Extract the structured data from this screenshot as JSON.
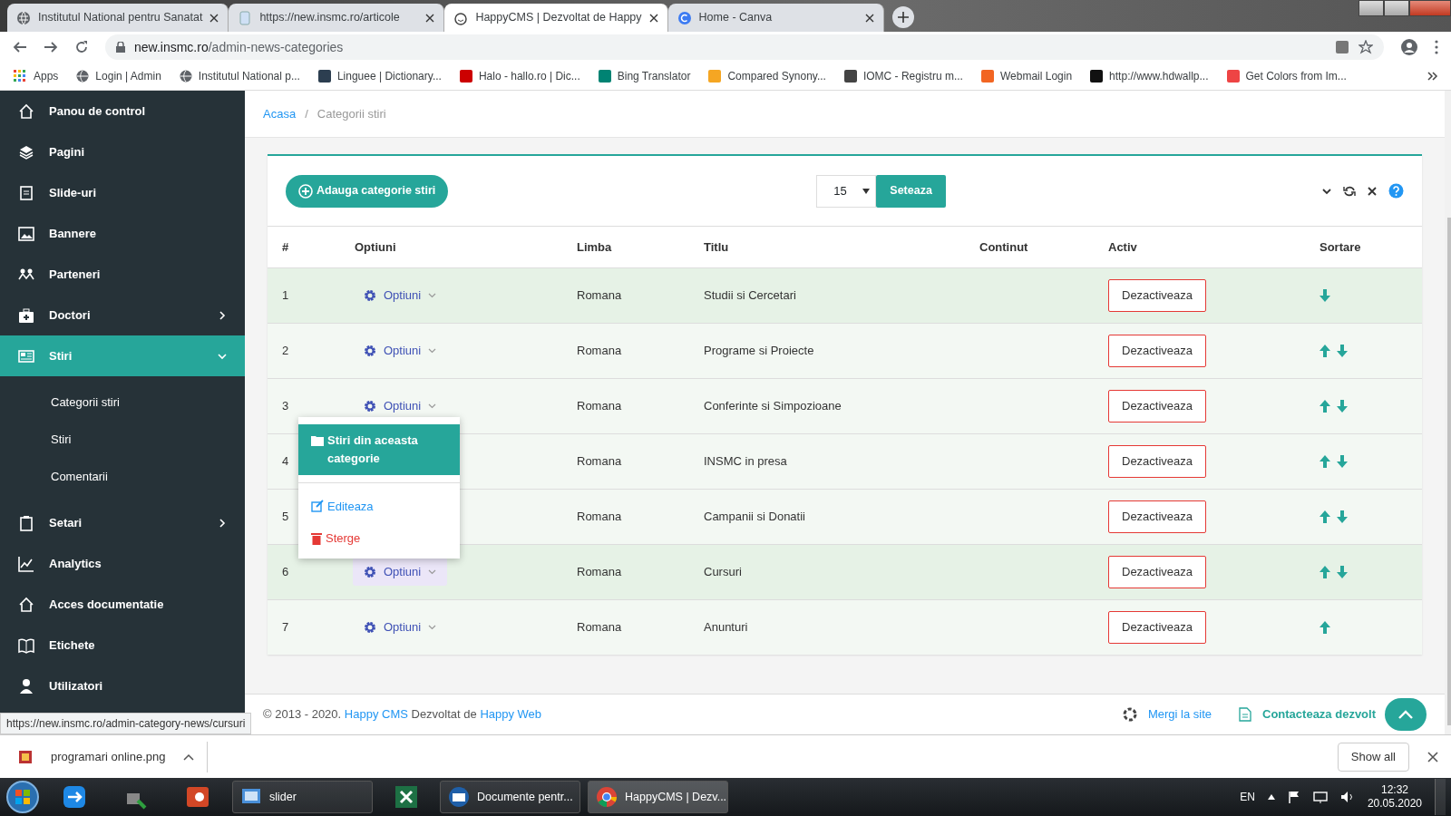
{
  "browser": {
    "tabs": [
      {
        "title": "Institutul National pentru Sanatat",
        "selected": false
      },
      {
        "title": "https://new.insmc.ro/articole",
        "selected": false
      },
      {
        "title": "HappyCMS | Dezvoltat de Happy",
        "selected": true
      },
      {
        "title": "Home - Canva",
        "selected": false
      }
    ],
    "address": {
      "host": "new.insmc.ro",
      "path": "/admin-news-categories"
    },
    "bookmarks": [
      "Apps",
      "Login | Admin",
      "Institutul National p...",
      "Linguee | Dictionary...",
      "Halo - hallo.ro | Dic...",
      "Bing Translator",
      "Compared Synony...",
      "IOMC - Registru m...",
      "Webmail Login",
      "http://www.hdwallp...",
      "Get Colors from Im..."
    ]
  },
  "sidebar": {
    "items": [
      {
        "label": "Panou de control",
        "kind": "link",
        "selected": false
      },
      {
        "label": "Pagini",
        "kind": "link",
        "selected": false
      },
      {
        "label": "Slide-uri",
        "kind": "link",
        "selected": false
      },
      {
        "label": "Bannere",
        "kind": "link",
        "selected": false
      },
      {
        "label": "Parteneri",
        "kind": "link",
        "selected": false
      },
      {
        "label": "Doctori",
        "kind": "submenu",
        "selected": false,
        "expanded": false
      },
      {
        "label": "Stiri",
        "kind": "submenu",
        "selected": true,
        "expanded": true,
        "children": [
          {
            "label": "Categorii stiri"
          },
          {
            "label": "Stiri"
          },
          {
            "label": "Comentarii"
          }
        ]
      },
      {
        "label": "Setari",
        "kind": "submenu",
        "selected": false,
        "expanded": false
      },
      {
        "label": "Analytics",
        "kind": "link",
        "selected": false
      },
      {
        "label": "Acces documentatie",
        "kind": "link",
        "selected": false
      },
      {
        "label": "Etichete",
        "kind": "link",
        "selected": false
      },
      {
        "label": "Utilizatori",
        "kind": "link",
        "selected": false
      }
    ]
  },
  "breadcrumb_separator": "/",
  "breadcrumb": [
    {
      "label": "Acasa",
      "kind": "link"
    },
    {
      "label": "Categorii stiri",
      "kind": "current"
    }
  ],
  "toolbar": {
    "add_button": "Adauga categorie stiri",
    "page_size": "15",
    "set_button": "Seteaza"
  },
  "table": {
    "columns": [
      "#",
      "Optiuni",
      "Limba",
      "Titlu",
      "Continut",
      "Activ",
      "Sortare"
    ],
    "rows": [
      {
        "number": "1",
        "options": "Optiuni",
        "language": "Romana",
        "title": "Studii si Cercetari",
        "active_button": "Dezactiveaza",
        "can_move_up": false,
        "can_move_down": true,
        "highlighted": true,
        "options_focused": false
      },
      {
        "number": "2",
        "options": "Optiuni",
        "language": "Romana",
        "title": "Programe si Proiecte",
        "active_button": "Dezactiveaza",
        "can_move_up": true,
        "can_move_down": true,
        "highlighted": false,
        "options_focused": false
      },
      {
        "number": "3",
        "options": "Optiuni",
        "language": "Romana",
        "title": "Conferinte si Simpozioane",
        "active_button": "Dezactiveaza",
        "can_move_up": true,
        "can_move_down": true,
        "highlighted": false,
        "options_focused": false,
        "menu": {
          "items": [
            {
              "label": "Stiri din aceasta categorie",
              "kind": "primary"
            },
            {
              "label": "Editeaza",
              "kind": "edit"
            },
            {
              "label": "Sterge",
              "kind": "delete"
            }
          ]
        }
      },
      {
        "number": "4",
        "language": "Romana",
        "title": "INSMC in presa",
        "active_button": "Dezactiveaza",
        "can_move_up": true,
        "can_move_down": true,
        "highlighted": false
      },
      {
        "number": "5",
        "language": "Romana",
        "title": "Campanii si Donatii",
        "active_button": "Dezactiveaza",
        "can_move_up": true,
        "can_move_down": true,
        "highlighted": false
      },
      {
        "number": "6",
        "options": "Optiuni",
        "language": "Romana",
        "title": "Cursuri",
        "active_button": "Dezactiveaza",
        "can_move_up": true,
        "can_move_down": true,
        "highlighted": true,
        "options_focused": true
      },
      {
        "number": "7",
        "options": "Optiuni",
        "language": "Romana",
        "title": "Anunturi",
        "active_button": "Dezactiveaza",
        "can_move_up": true,
        "can_move_down": false,
        "highlighted": false,
        "options_focused": false
      }
    ]
  },
  "footer": {
    "copyright": [
      {
        "text": "© 2013 - 2020. ",
        "kind": "text"
      },
      {
        "text": "Happy CMS",
        "kind": "link"
      },
      {
        "text": " Dezvoltat de ",
        "kind": "text"
      },
      {
        "text": "Happy Web",
        "kind": "link"
      }
    ],
    "links": [
      {
        "label": "Mergi la site",
        "kind": "site"
      },
      {
        "label": "Contacteaza dezvolt",
        "kind": "contact"
      }
    ]
  },
  "status_url": "https://new.insmc.ro/admin-category-news/cursuri",
  "downloads": {
    "file": "programari online.png",
    "show_all": "Show all"
  },
  "taskbar": {
    "buttons": [
      {
        "label": "slider",
        "selected": false
      },
      {
        "label": "Documente pentr...",
        "selected": false
      },
      {
        "label": "HappyCMS | Dezv...",
        "selected": true
      }
    ],
    "language": "EN",
    "time": "12:32",
    "date": "20.05.2020"
  }
}
